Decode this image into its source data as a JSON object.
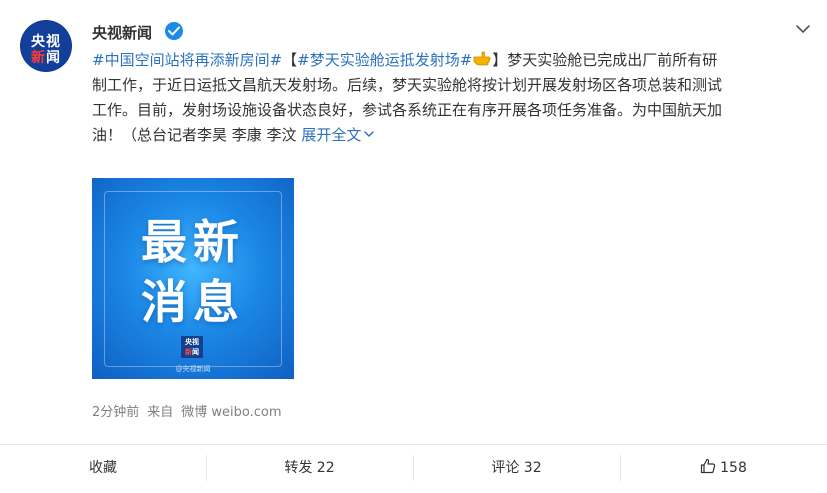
{
  "author": {
    "name": "央视新闻",
    "avatar_text_top": "央视",
    "avatar_text_bottom_left": "新",
    "avatar_text_bottom_right": "闻"
  },
  "post": {
    "line1": {
      "tag1": "#中国空间站将再添新房间#",
      "bracket_open": "【",
      "tag2": "#梦天实验舱运抵发射场#",
      "bracket_close_text": "】梦天实验舱已完成出厂前所有研"
    },
    "line2": "制工作，于近日运抵文昌航天发射场。后续，梦天实验舱将按计划开展发射场区各项总装和测试",
    "line3": "工作。目前，发射场设施设备状态良好，参试各系统正在有序开展各项任务准备。为中国航天加",
    "line4_text": "油！（总台记者李昊 李康 李汶 ",
    "expand_label": "展开全文"
  },
  "image": {
    "line1": "最新",
    "line2": "消息",
    "logo_top": "央视",
    "logo_bottom_left": "新",
    "logo_bottom_right": "闻",
    "watermark": "@央视新闻"
  },
  "meta": {
    "time": "2分钟前",
    "source_prefix": "来自",
    "source": "微博 weibo.com"
  },
  "actions": {
    "collect": "收藏",
    "repost": "转发 22",
    "comment": "评论 32",
    "like_count": "158"
  },
  "colors": {
    "topic_orange": "#eb7350",
    "link_blue": "#2b71bf",
    "verified_blue": "#1a8ce8"
  },
  "icons": [
    "verified-icon",
    "chevron-down-icon",
    "pointing-hand-emoji",
    "thumbs-up-icon"
  ]
}
